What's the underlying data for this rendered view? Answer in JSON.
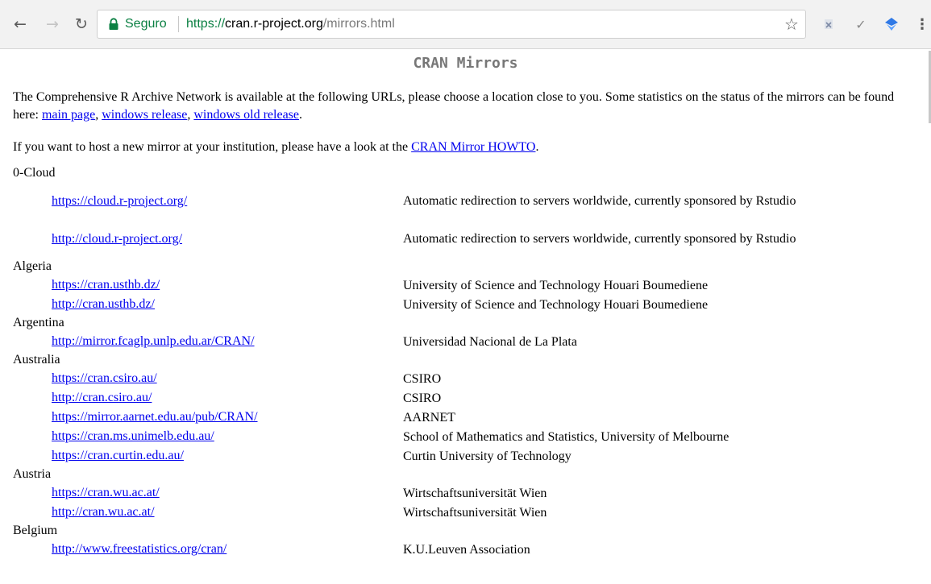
{
  "browser": {
    "secure_label": "Seguro",
    "url": {
      "proto": "https://",
      "host": "cran.r-project.org",
      "path": "/mirrors.html"
    }
  },
  "page": {
    "title": "CRAN Mirrors",
    "intro_text": "The Comprehensive R Archive Network is available at the following URLs, please choose a location close to you. Some statistics on the status of the mirrors can be found here:",
    "links": [
      "main page",
      "windows release",
      "windows old release"
    ],
    "host_text": "If you want to host a new mirror at your institution, please have a look at the",
    "howto_link": "CRAN Mirror HOWTO"
  },
  "mirrors": [
    {
      "country": "0-Cloud",
      "entries": [
        {
          "url": "https://cloud.r-project.org/",
          "host": "Automatic redirection to servers worldwide, currently sponsored by Rstudio"
        },
        {
          "url": "http://cloud.r-project.org/",
          "host": "Automatic redirection to servers worldwide, currently sponsored by Rstudio"
        }
      ]
    },
    {
      "country": "Algeria",
      "entries": [
        {
          "url": "https://cran.usthb.dz/",
          "host": "University of Science and Technology Houari Boumediene"
        },
        {
          "url": "http://cran.usthb.dz/",
          "host": "University of Science and Technology Houari Boumediene"
        }
      ]
    },
    {
      "country": "Argentina",
      "entries": [
        {
          "url": "http://mirror.fcaglp.unlp.edu.ar/CRAN/",
          "host": "Universidad Nacional de La Plata"
        }
      ]
    },
    {
      "country": "Australia",
      "entries": [
        {
          "url": "https://cran.csiro.au/",
          "host": "CSIRO"
        },
        {
          "url": "http://cran.csiro.au/",
          "host": "CSIRO"
        },
        {
          "url": "https://mirror.aarnet.edu.au/pub/CRAN/",
          "host": "AARNET"
        },
        {
          "url": "https://cran.ms.unimelb.edu.au/",
          "host": "School of Mathematics and Statistics, University of Melbourne"
        },
        {
          "url": "https://cran.curtin.edu.au/",
          "host": "Curtin University of Technology"
        }
      ]
    },
    {
      "country": "Austria",
      "entries": [
        {
          "url": "https://cran.wu.ac.at/",
          "host": "Wirtschaftsuniversität Wien"
        },
        {
          "url": "http://cran.wu.ac.at/",
          "host": "Wirtschaftsuniversität Wien"
        }
      ]
    },
    {
      "country": "Belgium",
      "entries": [
        {
          "url": "http://www.freestatistics.org/cran/",
          "host": "K.U.Leuven Association"
        }
      ]
    }
  ]
}
